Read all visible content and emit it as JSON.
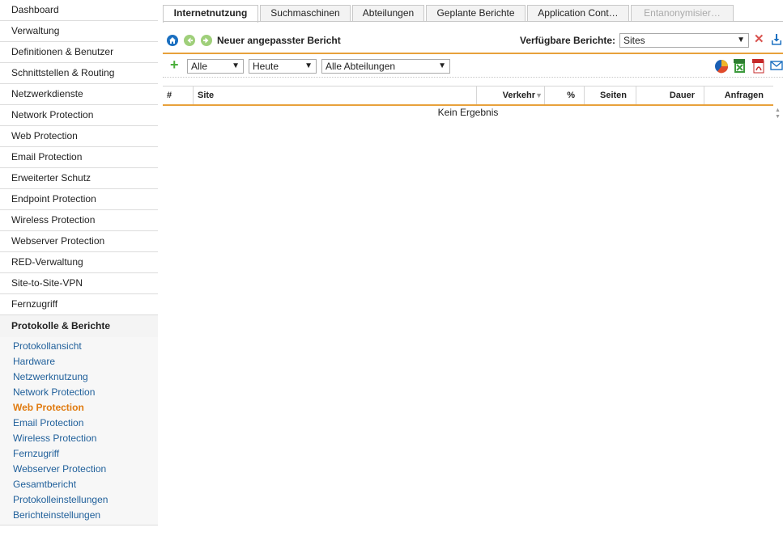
{
  "sidebar": {
    "items": [
      {
        "label": "Dashboard"
      },
      {
        "label": "Verwaltung"
      },
      {
        "label": "Definitionen & Benutzer"
      },
      {
        "label": "Schnittstellen & Routing"
      },
      {
        "label": "Netzwerkdienste"
      },
      {
        "label": "Network Protection"
      },
      {
        "label": "Web Protection"
      },
      {
        "label": "Email Protection"
      },
      {
        "label": "Erweiterter Schutz"
      },
      {
        "label": "Endpoint Protection"
      },
      {
        "label": "Wireless Protection"
      },
      {
        "label": "Webserver Protection"
      },
      {
        "label": "RED-Verwaltung"
      },
      {
        "label": "Site-to-Site-VPN"
      },
      {
        "label": "Fernzugriff"
      }
    ],
    "active_section": "Protokolle & Berichte",
    "subitems": [
      {
        "label": "Protokollansicht"
      },
      {
        "label": "Hardware"
      },
      {
        "label": "Netzwerknutzung"
      },
      {
        "label": "Network Protection"
      },
      {
        "label": "Web Protection"
      },
      {
        "label": "Email Protection"
      },
      {
        "label": "Wireless Protection"
      },
      {
        "label": "Fernzugriff"
      },
      {
        "label": "Webserver Protection"
      },
      {
        "label": "Gesamtbericht"
      },
      {
        "label": "Protokolleinstellungen"
      },
      {
        "label": "Berichteinstellungen"
      }
    ],
    "active_subitem": "Web Protection"
  },
  "tabs": [
    {
      "label": "Internetnutzung"
    },
    {
      "label": "Suchmaschinen"
    },
    {
      "label": "Abteilungen"
    },
    {
      "label": "Geplante Berichte"
    },
    {
      "label": "Application Cont…"
    },
    {
      "label": "Entanonymisier…"
    }
  ],
  "report": {
    "title": "Neuer angepasster Bericht",
    "available_label": "Verfügbare Berichte:",
    "selected_report": "Sites"
  },
  "filters": {
    "scope": "Alle",
    "period": "Heute",
    "department": "Alle Abteilungen"
  },
  "table": {
    "columns": [
      "#",
      "Site",
      "Verkehr",
      "%",
      "Seiten",
      "Dauer",
      "Anfragen"
    ],
    "empty_text": "Kein Ergebnis"
  },
  "colors": {
    "accent": "#e8a13b",
    "link": "#1f5f9a",
    "active_link": "#e07b10"
  }
}
